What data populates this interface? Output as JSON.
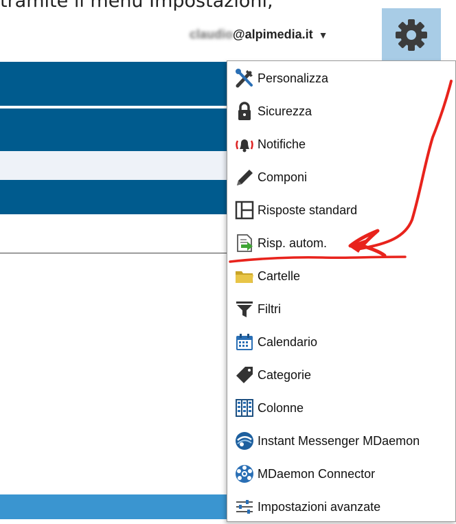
{
  "caption": "tramite il menu Impostazioni,",
  "account": {
    "email_blurred": "claudio",
    "email_domain": "@alpimedia.it",
    "caret": "▼"
  },
  "gear_button": {
    "icon": "gear-icon"
  },
  "menu": {
    "items": [
      {
        "label": "Personalizza",
        "icon": "tools-icon"
      },
      {
        "label": "Sicurezza",
        "icon": "lock-icon"
      },
      {
        "label": "Notifiche",
        "icon": "bell-icon"
      },
      {
        "label": "Componi",
        "icon": "pencil-icon"
      },
      {
        "label": "Risposte standard",
        "icon": "template-icon"
      },
      {
        "label": "Risp. autom.",
        "icon": "autoreply-icon"
      },
      {
        "label": "Cartelle",
        "icon": "folder-icon"
      },
      {
        "label": "Filtri",
        "icon": "filter-icon"
      },
      {
        "label": "Calendario",
        "icon": "calendar-icon"
      },
      {
        "label": "Categorie",
        "icon": "tag-icon"
      },
      {
        "label": "Colonne",
        "icon": "columns-icon"
      },
      {
        "label": "Instant Messenger MDaemon",
        "icon": "messenger-icon"
      },
      {
        "label": "MDaemon Connector",
        "icon": "connector-icon"
      },
      {
        "label": "Impostazioni avanzate",
        "icon": "sliders-icon"
      }
    ]
  },
  "colors": {
    "header_band": "#005b8e",
    "gear_bg": "#a8cce6",
    "annotation": "#e8231c"
  }
}
